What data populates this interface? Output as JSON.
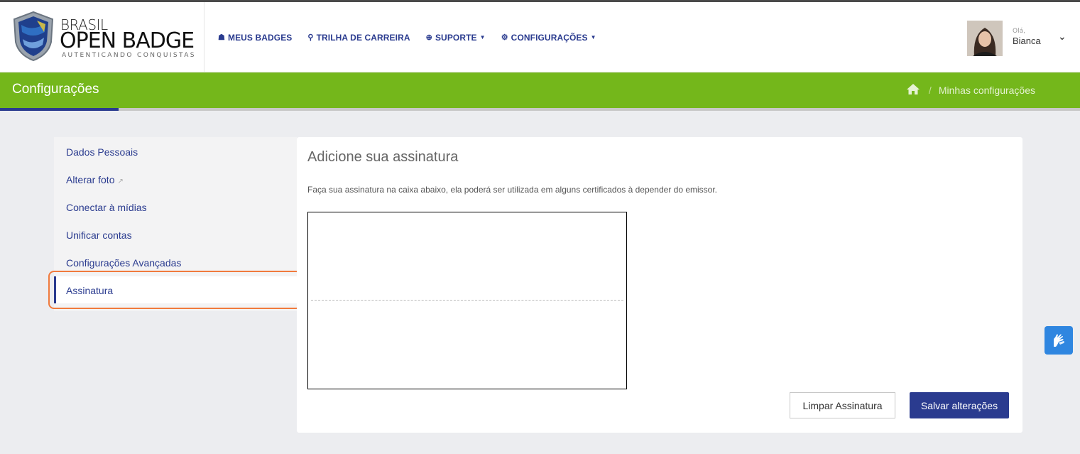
{
  "logo": {
    "line1": "BRASIL",
    "line2": "OPEN BADGE",
    "line3": "AUTENTICANDO CONQUISTAS"
  },
  "nav": [
    {
      "icon": "graduation-cap-icon",
      "glyph": "☗",
      "label": "MEUS BADGES"
    },
    {
      "icon": "trophy-icon",
      "glyph": "🏆︎",
      "label": "TRILHA DE CARREIRA"
    },
    {
      "icon": "lifebuoy-icon",
      "glyph": "⊕",
      "label": "SUPORTE"
    },
    {
      "icon": "cogs-icon",
      "glyph": "⚙",
      "label": "CONFIGURAÇÕES"
    }
  ],
  "user": {
    "greeting": "Olá,",
    "name": "Bianca"
  },
  "page_header": {
    "title": "Configurações",
    "breadcrumb": "Minhas configurações"
  },
  "sidebar": {
    "items": [
      {
        "label": "Dados Pessoais"
      },
      {
        "label": "Alterar foto"
      },
      {
        "label": "Conectar à mídias"
      },
      {
        "label": "Unificar contas"
      },
      {
        "label": "Configurações Avançadas"
      },
      {
        "label": "Assinatura"
      }
    ],
    "active": "Assinatura"
  },
  "panel": {
    "title": "Adicione sua assinatura",
    "description": "Faça sua assinatura na caixa abaixo, ela poderá ser utilizada em alguns certificados à depender do emissor.",
    "clear_button": "Limpar Assinatura",
    "save_button": "Salvar alterações"
  },
  "colors": {
    "primary": "#2a3b8f",
    "green": "#74b71b",
    "highlight": "#f07a3c",
    "accessibility": "#2f86e0"
  }
}
